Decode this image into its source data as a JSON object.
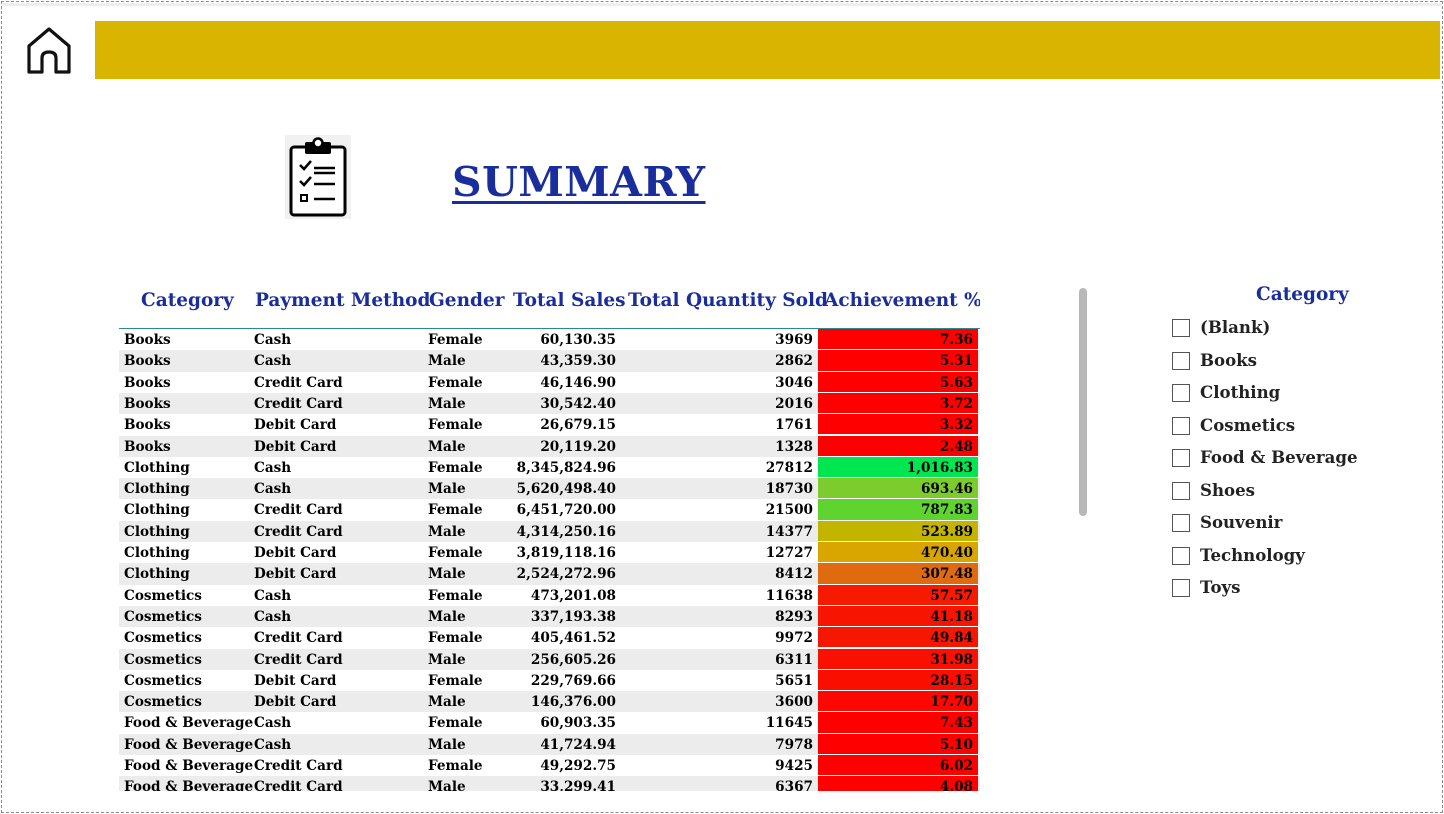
{
  "colors": {
    "banner": "#d9b400",
    "header_text": "#1a2d9c",
    "title_text": "#1a2d9c"
  },
  "nav": {
    "home_icon": "home-icon"
  },
  "page": {
    "title": "SUMMARY",
    "clipboard_icon": "clipboard-checklist-icon"
  },
  "table": {
    "headers": {
      "category": "Category",
      "payment": "Payment Method",
      "gender": "Gender",
      "sales": "Total Sales",
      "qty": "Total Quantity Sold",
      "ach": "Achievement %"
    },
    "rows": [
      {
        "category": "Books",
        "payment": "Cash",
        "gender": "Female",
        "sales": "60,130.35",
        "qty": "3969",
        "ach": "7.36",
        "ach_color": "#ff0000"
      },
      {
        "category": "Books",
        "payment": "Cash",
        "gender": "Male",
        "sales": "43,359.30",
        "qty": "2862",
        "ach": "5.31",
        "ach_color": "#ff0000"
      },
      {
        "category": "Books",
        "payment": "Credit Card",
        "gender": "Female",
        "sales": "46,146.90",
        "qty": "3046",
        "ach": "5.63",
        "ach_color": "#ff0000"
      },
      {
        "category": "Books",
        "payment": "Credit Card",
        "gender": "Male",
        "sales": "30,542.40",
        "qty": "2016",
        "ach": "3.72",
        "ach_color": "#ff0000"
      },
      {
        "category": "Books",
        "payment": "Debit Card",
        "gender": "Female",
        "sales": "26,679.15",
        "qty": "1761",
        "ach": "3.32",
        "ach_color": "#ff0000"
      },
      {
        "category": "Books",
        "payment": "Debit Card",
        "gender": "Male",
        "sales": "20,119.20",
        "qty": "1328",
        "ach": "2.48",
        "ach_color": "#ff0000"
      },
      {
        "category": "Clothing",
        "payment": "Cash",
        "gender": "Female",
        "sales": "8,345,824.96",
        "qty": "27812",
        "ach": "1,016.83",
        "ach_color": "#00e650"
      },
      {
        "category": "Clothing",
        "payment": "Cash",
        "gender": "Male",
        "sales": "5,620,498.40",
        "qty": "18730",
        "ach": "693.46",
        "ach_color": "#7ccc2e"
      },
      {
        "category": "Clothing",
        "payment": "Credit Card",
        "gender": "Female",
        "sales": "6,451,720.00",
        "qty": "21500",
        "ach": "787.83",
        "ach_color": "#5fd42e"
      },
      {
        "category": "Clothing",
        "payment": "Credit Card",
        "gender": "Male",
        "sales": "4,314,250.16",
        "qty": "14377",
        "ach": "523.89",
        "ach_color": "#c3b400"
      },
      {
        "category": "Clothing",
        "payment": "Debit Card",
        "gender": "Female",
        "sales": "3,819,118.16",
        "qty": "12727",
        "ach": "470.40",
        "ach_color": "#d9a600"
      },
      {
        "category": "Clothing",
        "payment": "Debit Card",
        "gender": "Male",
        "sales": "2,524,272.96",
        "qty": "8412",
        "ach": "307.48",
        "ach_color": "#e06a10"
      },
      {
        "category": "Cosmetics",
        "payment": "Cash",
        "gender": "Female",
        "sales": "473,201.08",
        "qty": "11638",
        "ach": "57.57",
        "ach_color": "#f51a00"
      },
      {
        "category": "Cosmetics",
        "payment": "Cash",
        "gender": "Male",
        "sales": "337,193.38",
        "qty": "8293",
        "ach": "41.18",
        "ach_color": "#f71400"
      },
      {
        "category": "Cosmetics",
        "payment": "Credit Card",
        "gender": "Female",
        "sales": "405,461.52",
        "qty": "9972",
        "ach": "49.84",
        "ach_color": "#f61700"
      },
      {
        "category": "Cosmetics",
        "payment": "Credit Card",
        "gender": "Male",
        "sales": "256,605.26",
        "qty": "6311",
        "ach": "31.98",
        "ach_color": "#f91000"
      },
      {
        "category": "Cosmetics",
        "payment": "Debit Card",
        "gender": "Female",
        "sales": "229,769.66",
        "qty": "5651",
        "ach": "28.15",
        "ach_color": "#fa0e00"
      },
      {
        "category": "Cosmetics",
        "payment": "Debit Card",
        "gender": "Male",
        "sales": "146,376.00",
        "qty": "3600",
        "ach": "17.70",
        "ach_color": "#fc0800"
      },
      {
        "category": "Food & Beverage",
        "payment": "Cash",
        "gender": "Female",
        "sales": "60,903.35",
        "qty": "11645",
        "ach": "7.43",
        "ach_color": "#ff0000"
      },
      {
        "category": "Food & Beverage",
        "payment": "Cash",
        "gender": "Male",
        "sales": "41,724.94",
        "qty": "7978",
        "ach": "5.10",
        "ach_color": "#ff0000"
      },
      {
        "category": "Food & Beverage",
        "payment": "Credit Card",
        "gender": "Female",
        "sales": "49,292.75",
        "qty": "9425",
        "ach": "6.02",
        "ach_color": "#ff0000"
      },
      {
        "category": "Food & Beverage",
        "payment": "Credit Card",
        "gender": "Male",
        "sales": "33,299.41",
        "qty": "6367",
        "ach": "4.08",
        "ach_color": "#ff0000"
      }
    ]
  },
  "slicer": {
    "title": "Category",
    "items": [
      {
        "label": "(Blank)",
        "checked": false
      },
      {
        "label": "Books",
        "checked": false
      },
      {
        "label": "Clothing",
        "checked": false
      },
      {
        "label": "Cosmetics",
        "checked": false
      },
      {
        "label": "Food & Beverage",
        "checked": false
      },
      {
        "label": "Shoes",
        "checked": false
      },
      {
        "label": "Souvenir",
        "checked": false
      },
      {
        "label": "Technology",
        "checked": false
      },
      {
        "label": "Toys",
        "checked": false
      }
    ]
  }
}
